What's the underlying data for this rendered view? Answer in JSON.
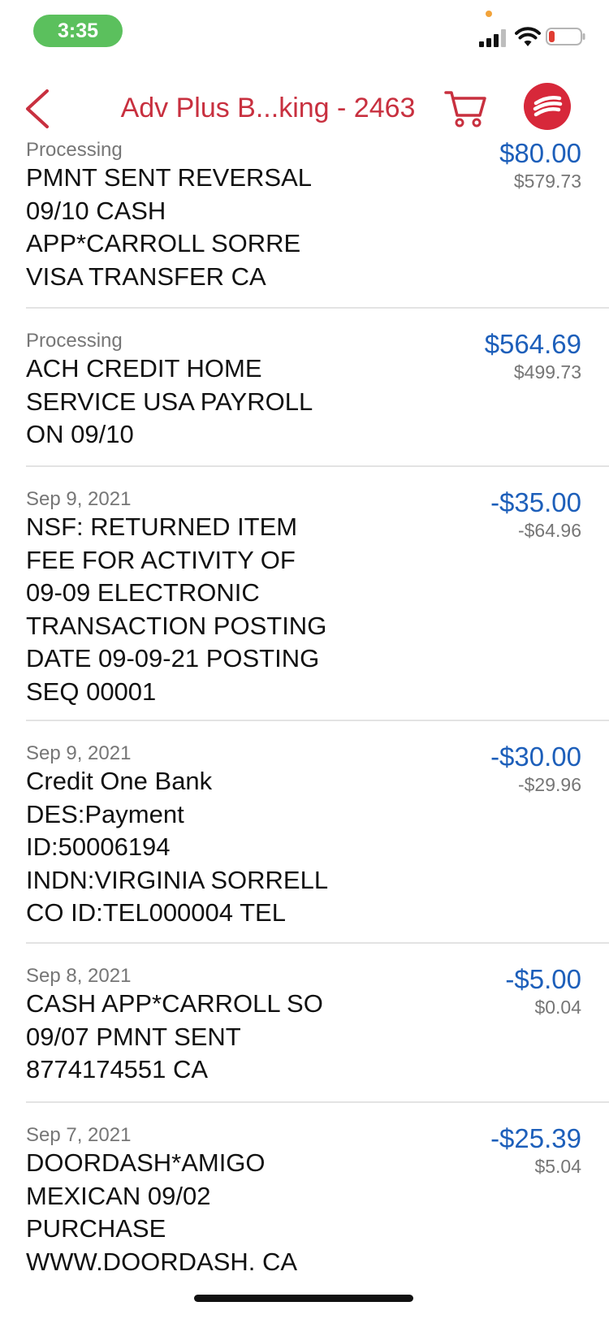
{
  "status_bar": {
    "time": "3:35"
  },
  "nav": {
    "back_icon": "chevron-left-icon",
    "title": "Adv Plus B...king - 2463",
    "cart_icon": "shopping-cart-icon",
    "logo_icon": "bank-of-america-flag-icon"
  },
  "colors": {
    "accent": "#c8303f",
    "amount_blue": "#1d5fba",
    "status_green": "#5bc05d"
  },
  "transactions": [
    {
      "date": "Processing",
      "description": "PMNT SENT REVERSAL\n09/10 CASH\nAPP*CARROLL SORRE\nVISA TRANSFER CA",
      "amount": "$80.00",
      "balance": "$579.73"
    },
    {
      "date": "Processing",
      "description": "ACH CREDIT HOME\nSERVICE USA PAYROLL\nON 09/10",
      "amount": "$564.69",
      "balance": "$499.73"
    },
    {
      "date": "Sep 9, 2021",
      "description": "NSF: RETURNED ITEM\nFEE FOR ACTIVITY OF\n09-09 ELECTRONIC\nTRANSACTION POSTING\nDATE 09-09-21 POSTING\nSEQ 00001",
      "amount": "-$35.00",
      "balance": "-$64.96"
    },
    {
      "date": "Sep 9, 2021",
      "description": "Credit One Bank\nDES:Payment\nID:50006194\nINDN:VIRGINIA SORRELL\nCO ID:TEL000004 TEL",
      "amount": "-$30.00",
      "balance": "-$29.96"
    },
    {
      "date": "Sep 8, 2021",
      "description": "CASH APP*CARROLL SO\n09/07 PMNT SENT\n8774174551 CA",
      "amount": "-$5.00",
      "balance": "$0.04"
    },
    {
      "date": "Sep 7, 2021",
      "description": "DOORDASH*AMIGO\nMEXICAN 09/02\nPURCHASE\nWWW.DOORDASH. CA",
      "amount": "-$25.39",
      "balance": "$5.04"
    }
  ]
}
